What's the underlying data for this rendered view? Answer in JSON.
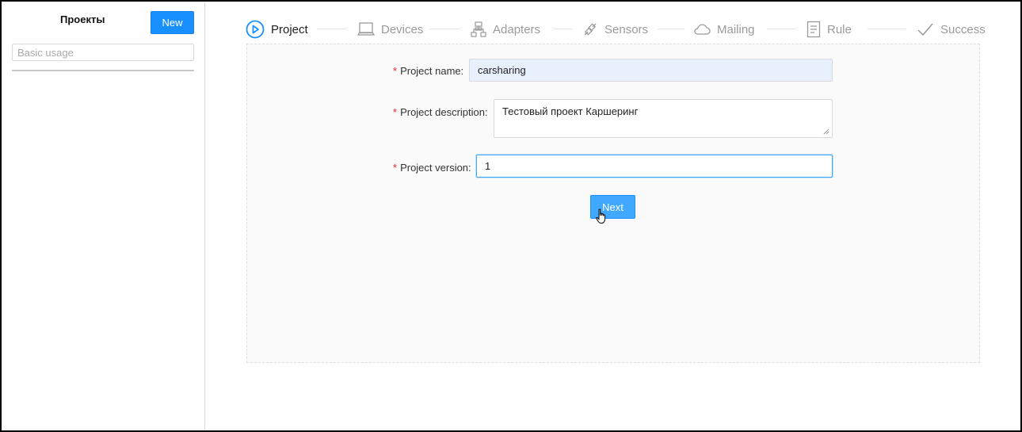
{
  "sidebar": {
    "title": "Проекты",
    "new_label": "New",
    "search_placeholder": "Basic usage"
  },
  "steps": [
    {
      "label": "Project",
      "icon": "play-circle-icon",
      "state": "active"
    },
    {
      "label": "Devices",
      "icon": "laptop-icon",
      "state": "wait"
    },
    {
      "label": "Adapters",
      "icon": "cluster-icon",
      "state": "wait"
    },
    {
      "label": "Sensors",
      "icon": "api-icon",
      "state": "wait"
    },
    {
      "label": "Mailing",
      "icon": "cloud-icon",
      "state": "wait"
    },
    {
      "label": "Rule",
      "icon": "file-text-icon",
      "state": "wait"
    },
    {
      "label": "Success",
      "icon": "check-icon",
      "state": "wait"
    }
  ],
  "form": {
    "required_mark": "*",
    "name_label": "Project name",
    "name_value": "carsharing",
    "description_label": "Project description",
    "description_value": "Тестовый проект Каршеринг",
    "version_label": "Project version",
    "version_value": "1",
    "label_suffix": ":"
  },
  "next_label": "Next",
  "colors": {
    "primary": "#1890ff",
    "required": "#f5222d",
    "autofill": "#e8f0fe"
  }
}
